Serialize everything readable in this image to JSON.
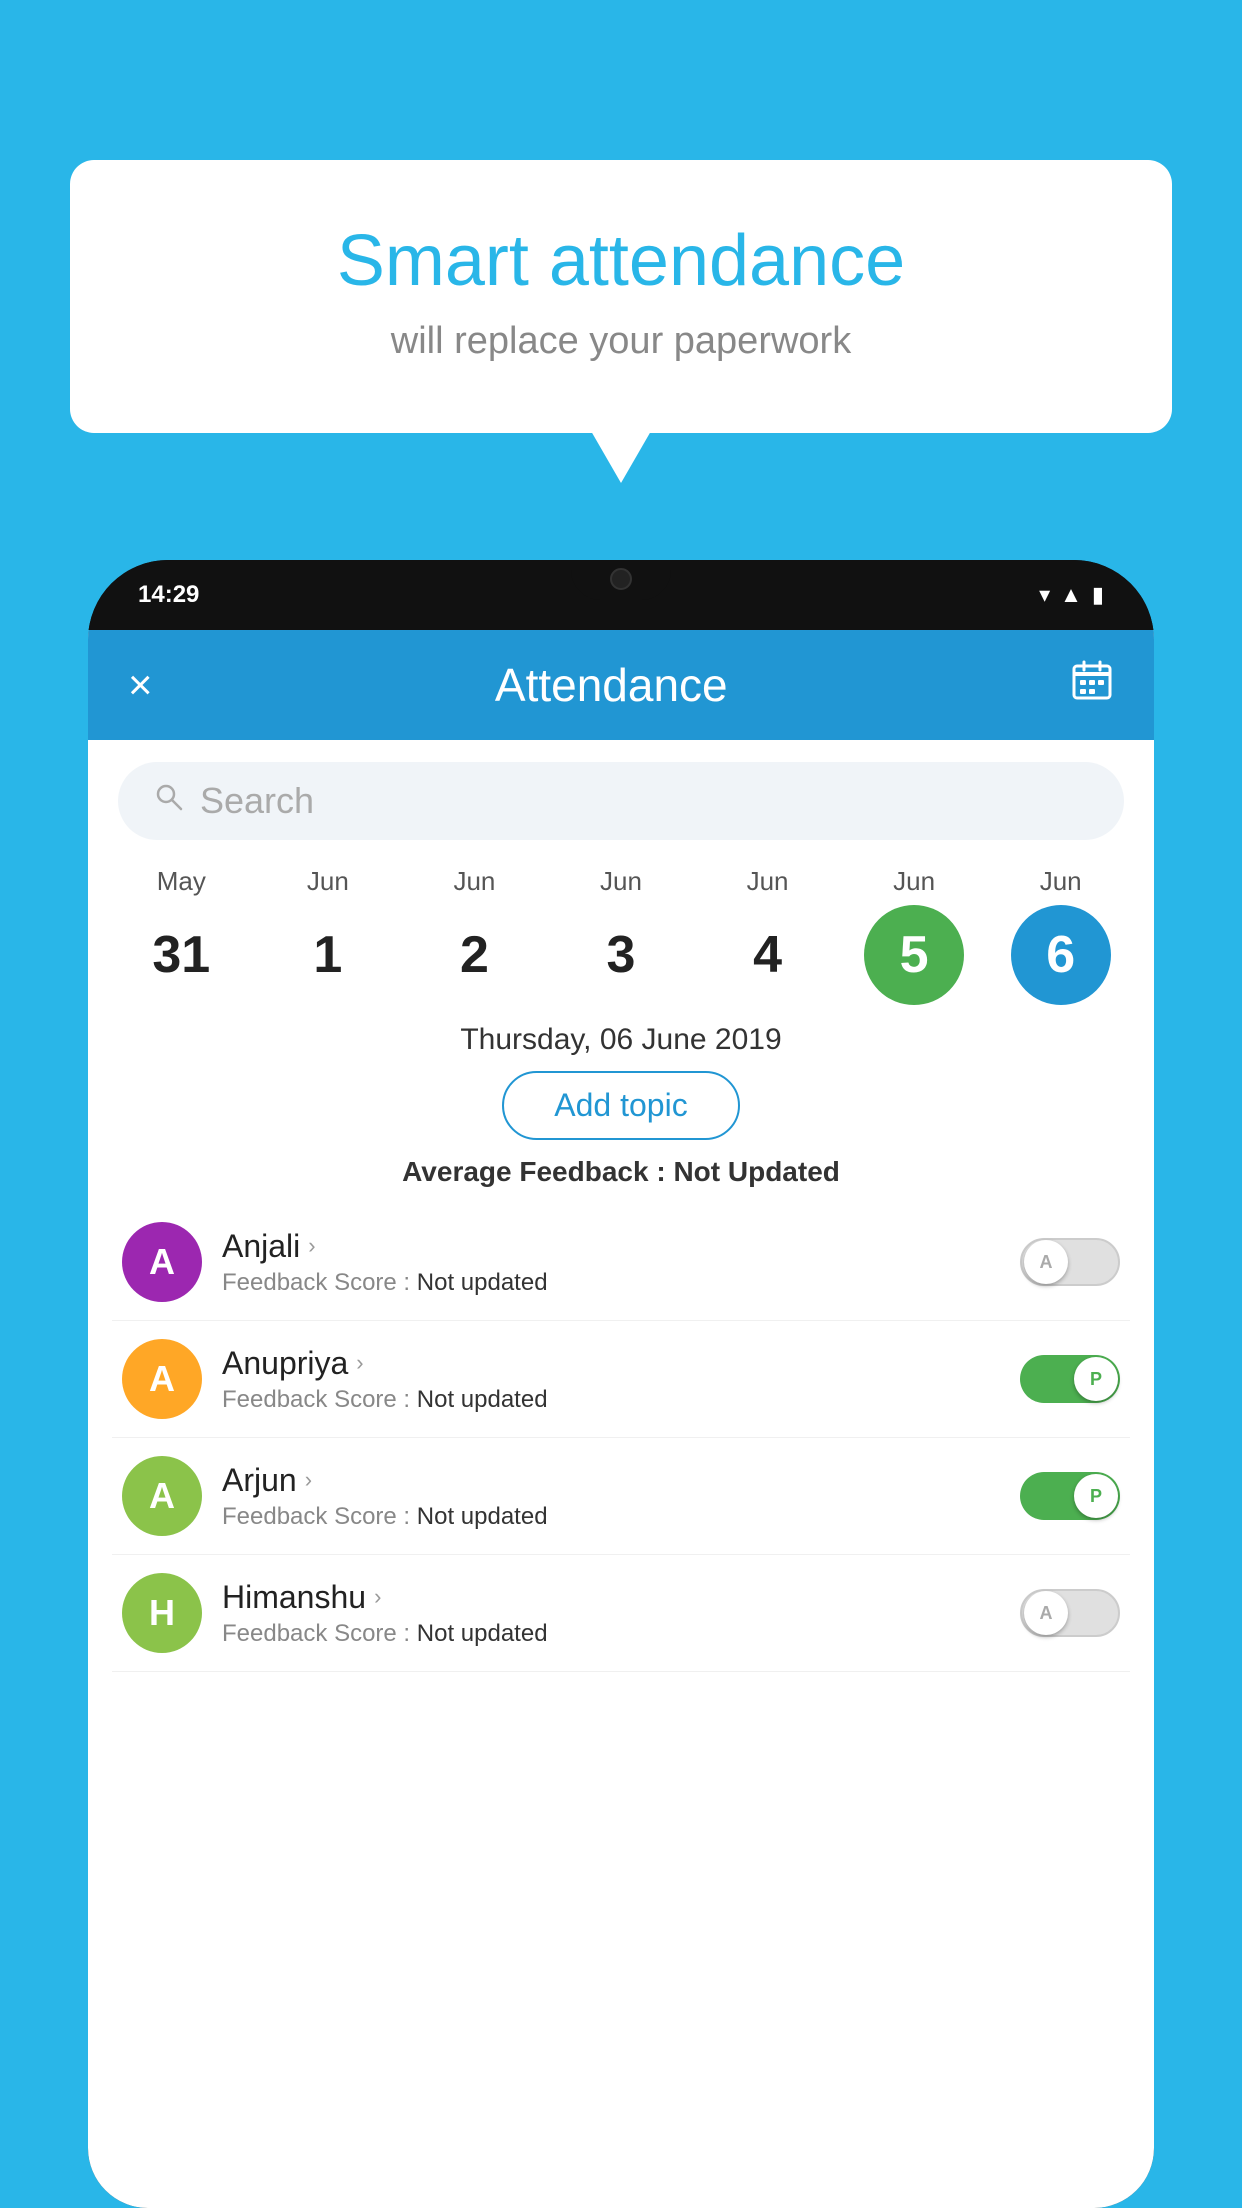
{
  "background_color": "#29b6e8",
  "bubble": {
    "title": "Smart attendance",
    "subtitle": "will replace your paperwork"
  },
  "phone": {
    "status_bar": {
      "time": "14:29"
    },
    "header": {
      "title": "Attendance",
      "close_label": "×",
      "calendar_icon": "calendar-icon"
    },
    "search": {
      "placeholder": "Search"
    },
    "dates": [
      {
        "month": "May",
        "day": "31",
        "state": "normal"
      },
      {
        "month": "Jun",
        "day": "1",
        "state": "normal"
      },
      {
        "month": "Jun",
        "day": "2",
        "state": "normal"
      },
      {
        "month": "Jun",
        "day": "3",
        "state": "normal"
      },
      {
        "month": "Jun",
        "day": "4",
        "state": "normal"
      },
      {
        "month": "Jun",
        "day": "5",
        "state": "today"
      },
      {
        "month": "Jun",
        "day": "6",
        "state": "selected"
      }
    ],
    "selected_date_label": "Thursday, 06 June 2019",
    "add_topic_btn": "Add topic",
    "avg_feedback_label": "Average Feedback :",
    "avg_feedback_value": "Not Updated",
    "students": [
      {
        "name": "Anjali",
        "avatar_letter": "A",
        "avatar_color": "#9c27b0",
        "feedback_label": "Feedback Score :",
        "feedback_value": "Not updated",
        "toggle_state": "off",
        "toggle_letter": "A"
      },
      {
        "name": "Anupriya",
        "avatar_letter": "A",
        "avatar_color": "#ffa726",
        "feedback_label": "Feedback Score :",
        "feedback_value": "Not updated",
        "toggle_state": "on",
        "toggle_letter": "P"
      },
      {
        "name": "Arjun",
        "avatar_letter": "A",
        "avatar_color": "#8bc34a",
        "feedback_label": "Feedback Score :",
        "feedback_value": "Not updated",
        "toggle_state": "on",
        "toggle_letter": "P"
      },
      {
        "name": "Himanshu",
        "avatar_letter": "H",
        "avatar_color": "#8bc34a",
        "feedback_label": "Feedback Score :",
        "feedback_value": "Not updated",
        "toggle_state": "off",
        "toggle_letter": "A"
      }
    ]
  }
}
